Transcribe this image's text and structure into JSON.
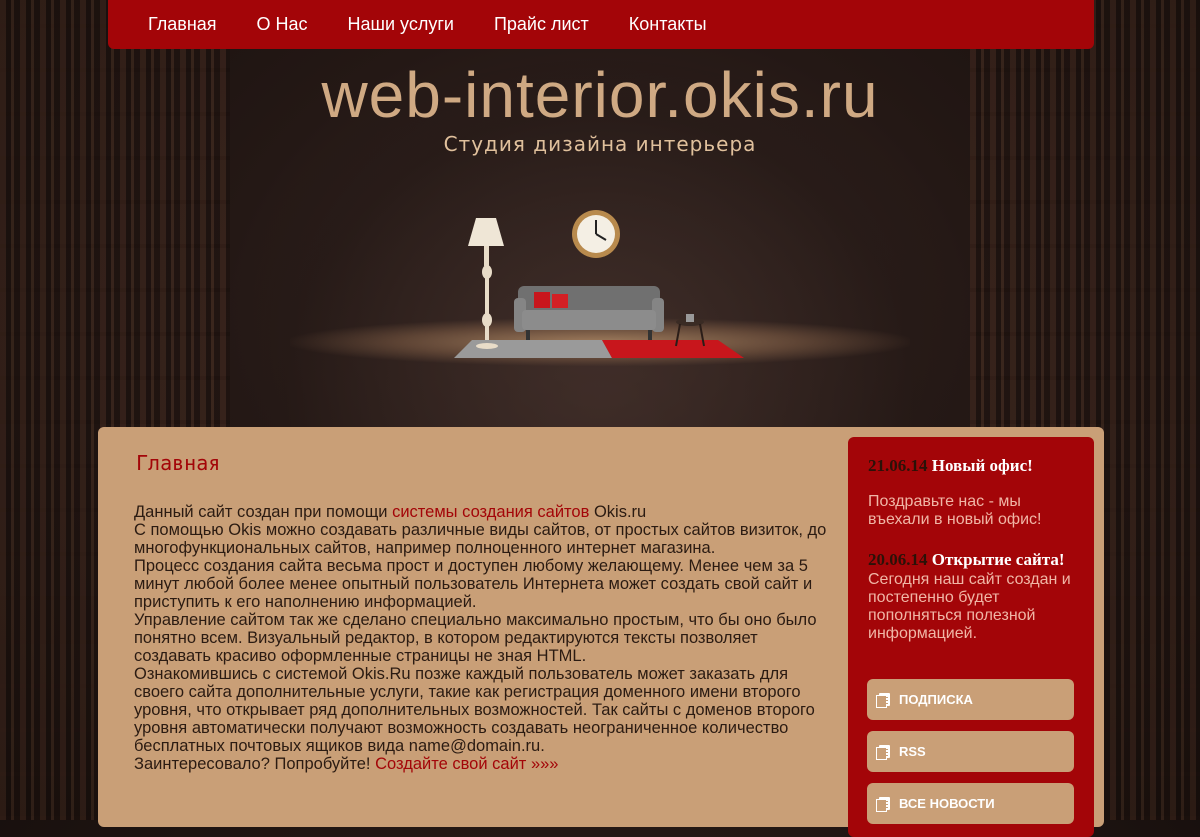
{
  "nav": {
    "items": [
      "Главная",
      "О Нас",
      "Наши услуги",
      "Прайс лист",
      "Контакты"
    ]
  },
  "header": {
    "site_title": "web-interior.okis.ru",
    "slogan": "Студия дизайна интерьера"
  },
  "main": {
    "heading": "Главная",
    "p1_text": "Данный сайт создан при помощи ",
    "p1_link": "системы создания сайтов",
    "p1_after": " Okis.ru",
    "p2": "С помощью Okis можно создавать различные виды сайтов, от простых сайтов визиток, до многофункциональных сайтов, например полноценного интернет магазина.",
    "p3": "Процесс создания сайта весьма прост и доступен любому желающему. Менее чем за 5 минут любой более менее опытный пользователь Интернета может создать свой сайт и приступить к его наполнению информацией.",
    "p4": "Управление сайтом так же сделано специально максимально простым, что бы оно было понятно всем. Визуальный редактор, в котором редактируются тексты позволяет создавать красиво оформленные страницы не зная HTML.",
    "p5": "Ознакомившись с системой Okis.Ru позже каждый пользователь может заказать для своего сайта дополнительные услуги, такие как регистрация доменного имени второго уровня, что открывает ряд дополнительных возможностей. Так сайты с доменов второго уровня автоматически получают возможность создавать неограниченное количество бесплатных почтовых ящиков вида name@domain.ru.",
    "p6_text": "Заинтересовало? Попробуйте! ",
    "p6_link": "Создайте свой сайт »»»"
  },
  "sidebar": {
    "news": [
      {
        "date": "21.06.14",
        "title": "Новый офис!",
        "body": "Поздравьте нас - мы въехали в новый офис!"
      },
      {
        "date": "20.06.14",
        "title": "Открытие сайта!",
        "body": "Сегодня наш сайт создан и постепенно будет пополняться полезной информацией."
      }
    ],
    "buttons": [
      {
        "label": "ПОДПИСКА",
        "icon": "documents-icon"
      },
      {
        "label": "RSS",
        "icon": "documents-icon"
      },
      {
        "label": "ВСЕ НОВОСТИ",
        "icon": "documents-icon"
      }
    ]
  },
  "colors": {
    "accent": "#a30508",
    "panel": "#c99f77",
    "title": "#cfa983"
  }
}
